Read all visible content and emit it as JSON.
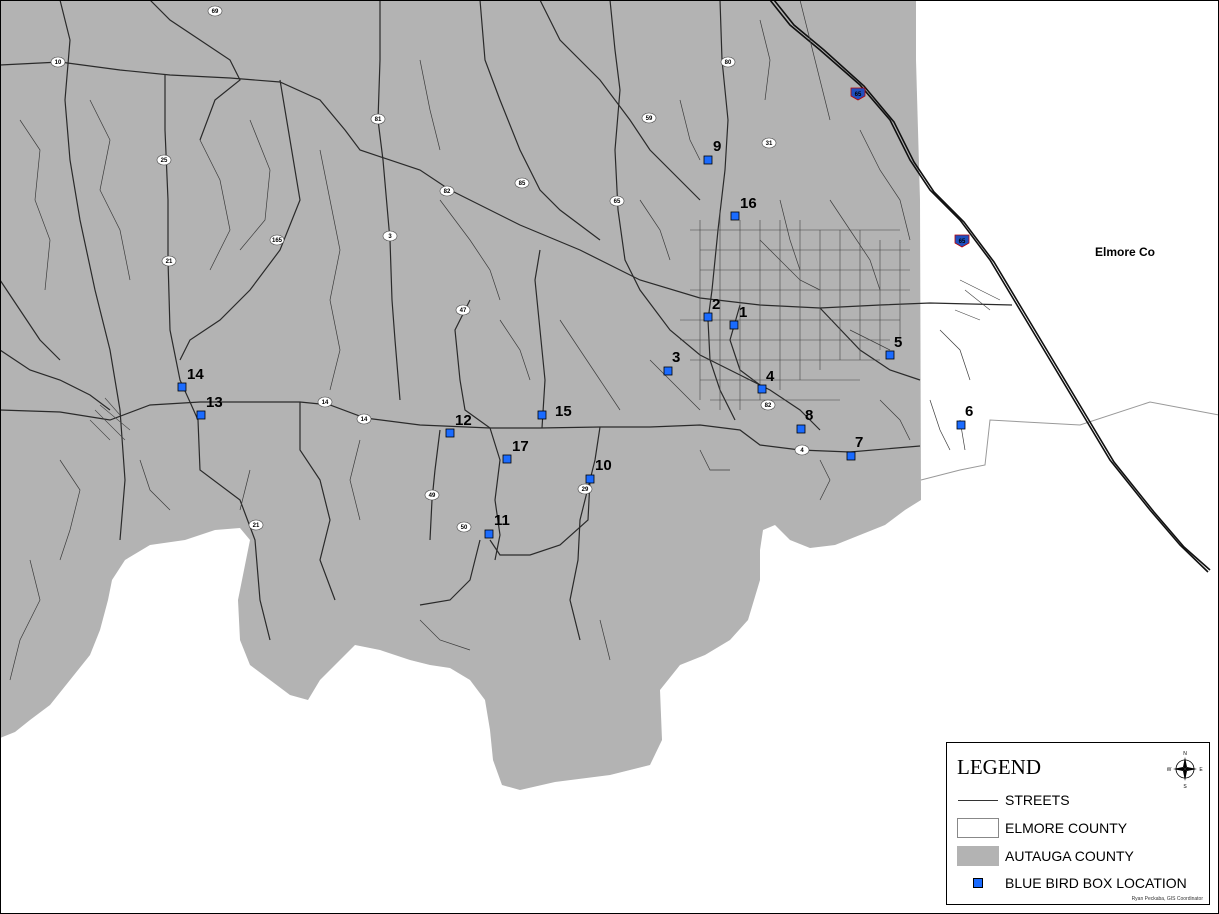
{
  "map": {
    "county_label": "Elmore Co",
    "routes": [
      "69",
      "80",
      "59",
      "31",
      "65",
      "10",
      "25",
      "21",
      "81",
      "82",
      "165",
      "3",
      "47",
      "85",
      "14",
      "14",
      "4",
      "29",
      "50",
      "49",
      "21",
      "82",
      "65"
    ],
    "boxes": [
      {
        "label": "1"
      },
      {
        "label": "2"
      },
      {
        "label": "3"
      },
      {
        "label": "4"
      },
      {
        "label": "5"
      },
      {
        "label": "6"
      },
      {
        "label": "7"
      },
      {
        "label": "8"
      },
      {
        "label": "9"
      },
      {
        "label": "10"
      },
      {
        "label": "11"
      },
      {
        "label": "12"
      },
      {
        "label": "13"
      },
      {
        "label": "14"
      },
      {
        "label": "15"
      },
      {
        "label": "16"
      },
      {
        "label": "17"
      }
    ],
    "colors": {
      "autauga": "#b3b3b3",
      "elmore": "#ffffff",
      "street": "#2a2a2a",
      "box": "#1a6bff"
    }
  },
  "legend": {
    "title": "LEGEND",
    "items": [
      {
        "label": "STREETS",
        "icon": "line-icon"
      },
      {
        "label": "ELMORE COUNTY",
        "icon": "white-swatch"
      },
      {
        "label": "AUTAUGA COUNTY",
        "icon": "gray-swatch"
      },
      {
        "label": "BLUE BIRD BOX LOCATION",
        "icon": "blue-square-icon"
      }
    ],
    "compass": {
      "n": "N",
      "s": "S",
      "e": "E",
      "w": "W"
    },
    "credit": "Ryan Peckaba, GIS Coordinator"
  }
}
